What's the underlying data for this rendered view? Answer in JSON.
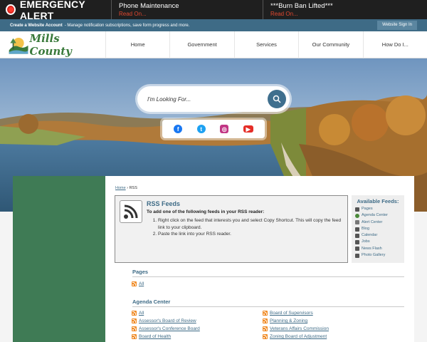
{
  "alert": {
    "title": "EMERGENCY ALERT",
    "items": [
      {
        "title": "Phone Maintenance",
        "read_on": "Read On..."
      },
      {
        "title": "***Burn Ban Lifted***",
        "read_on": "Read On..."
      }
    ]
  },
  "account_bar": {
    "create_label": "Create a Website Account",
    "create_desc": "- Manage notification subscriptions, save form progress and more.",
    "signin_label": "Website Sign In"
  },
  "logo": {
    "text": "Mills County"
  },
  "nav": {
    "items": [
      "Home",
      "Government",
      "Services",
      "Our Community",
      "How Do I..."
    ]
  },
  "search": {
    "placeholder": "I'm Looking For..."
  },
  "social": [
    "facebook-icon",
    "twitter-icon",
    "instagram-icon",
    "youtube-icon"
  ],
  "breadcrumb": {
    "home": "Home",
    "separator": "›",
    "current": "RSS"
  },
  "rss": {
    "title": "RSS Feeds",
    "subtitle": "To add one of the following feeds in your RSS reader:",
    "steps": [
      "Right click on the feed that interests you and select Copy Shortcut. This will copy the feed link to your clipboard.",
      "Paste the link into your RSS reader."
    ]
  },
  "available_feeds": {
    "title": "Available Feeds:",
    "items": [
      "Pages",
      "Agenda Center",
      "Alert Center",
      "Blog",
      "Calendar",
      "Jobs",
      "News Flash",
      "Photo Gallery"
    ]
  },
  "sections": {
    "pages": {
      "title": "Pages",
      "links": [
        "All"
      ]
    },
    "agenda": {
      "title": "Agenda Center",
      "left": [
        "All",
        "Assessor's Board of Review",
        "Assessor's Conference Board",
        "Board of Health"
      ],
      "right": [
        "Board of Supervisors",
        "Planning & Zoning",
        "Veterans Affairs Commission",
        "Zoning Board of Adjustment"
      ]
    }
  },
  "colors": {
    "accent": "#3e6b86",
    "green": "#3f7b55",
    "alert_red": "#d7261e"
  }
}
